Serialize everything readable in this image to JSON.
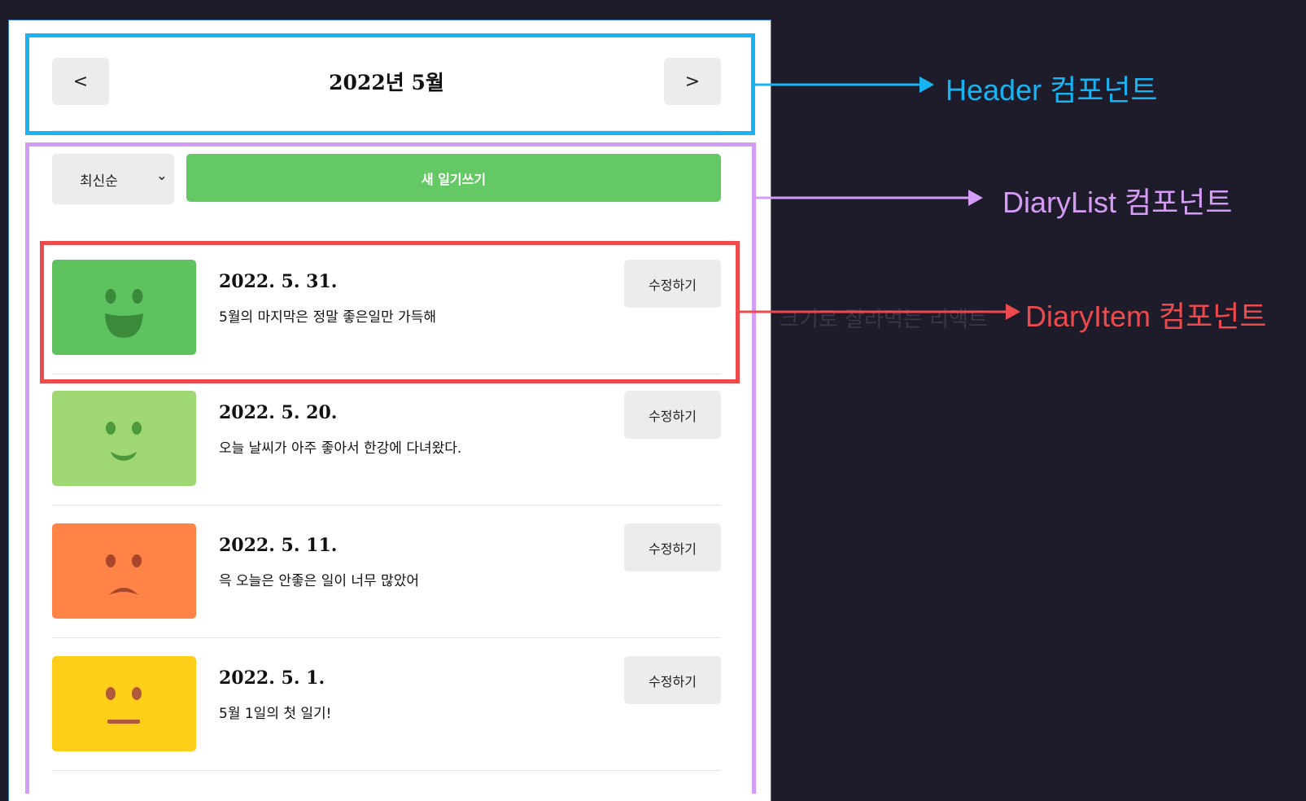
{
  "header": {
    "title": "2022년 5월",
    "prev_label": "<",
    "next_label": ">"
  },
  "controls": {
    "sort_value": "최신순",
    "new_button_label": "새 일기쓰기"
  },
  "diary_items": [
    {
      "date": "2022. 5. 31.",
      "content": "5월의 마지막은 정말 좋은일만 가득해",
      "edit_label": "수정하기",
      "emotion": "very-happy",
      "color": "#5ec25e"
    },
    {
      "date": "2022. 5. 20.",
      "content": "오늘 날씨가 아주 좋아서 한강에 다녀왔다.",
      "edit_label": "수정하기",
      "emotion": "happy",
      "color": "#9fd872"
    },
    {
      "date": "2022. 5. 11.",
      "content": "윽 오늘은 안좋은 일이 너무 많았어",
      "edit_label": "수정하기",
      "emotion": "sad",
      "color": "#fd8446"
    },
    {
      "date": "2022. 5. 1.",
      "content": "5월 1일의 첫 일기!",
      "edit_label": "수정하기",
      "emotion": "neutral",
      "color": "#fdce17"
    }
  ],
  "background_text": "한입 크기로 잘라먹는 리액트",
  "annotations": [
    {
      "label": "Header 컴포넌트",
      "color": "#18b3f2"
    },
    {
      "label": "DiaryList 컴포넌트",
      "color": "#d59cf5"
    },
    {
      "label": "DiaryItem 컴포넌트",
      "color": "#ec4a4d"
    }
  ]
}
